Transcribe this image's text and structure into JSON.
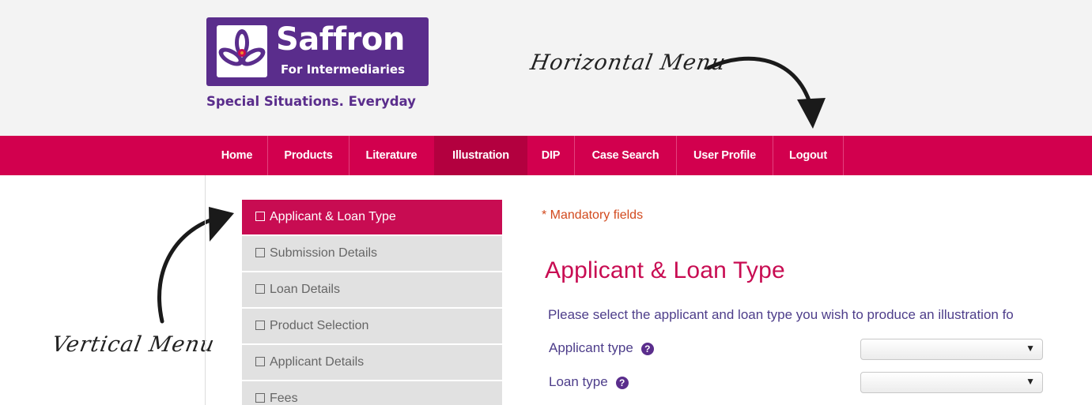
{
  "header": {
    "logo": {
      "name": "Saffron",
      "sub": "For Intermediaries"
    },
    "tagline": "Special Situations. Everyday"
  },
  "annotations": {
    "horizontal": "Horizontal Menu",
    "vertical": "Vertical Menu"
  },
  "nav": {
    "items": [
      {
        "label": "Home"
      },
      {
        "label": "Products"
      },
      {
        "label": "Literature"
      },
      {
        "label": "Illustration",
        "active": true
      },
      {
        "label": "DIP"
      },
      {
        "label": "Case Search"
      },
      {
        "label": "User Profile"
      },
      {
        "label": "Logout"
      }
    ]
  },
  "sidebar": {
    "items": [
      {
        "label": "Applicant & Loan Type",
        "active": true
      },
      {
        "label": "Submission Details"
      },
      {
        "label": "Loan Details"
      },
      {
        "label": "Product Selection"
      },
      {
        "label": "Applicant Details"
      },
      {
        "label": "Fees"
      }
    ]
  },
  "main": {
    "mandatory": "* Mandatory fields",
    "title": "Applicant & Loan Type",
    "intro": "Please select the applicant and loan type you wish to produce an illustration fo",
    "fields": [
      {
        "label": "Applicant type",
        "value": ""
      },
      {
        "label": "Loan type",
        "value": ""
      }
    ]
  },
  "icons": {
    "help": "question-circle-icon",
    "dropdown": "caret-down-icon",
    "checkbox": "checkbox-icon",
    "logo": "saffron-flower-icon"
  },
  "colors": {
    "brand_purple": "#5a2d8c",
    "nav_pink": "#d2004e",
    "nav_active": "#b3003f",
    "accent_red": "#c80c52"
  }
}
